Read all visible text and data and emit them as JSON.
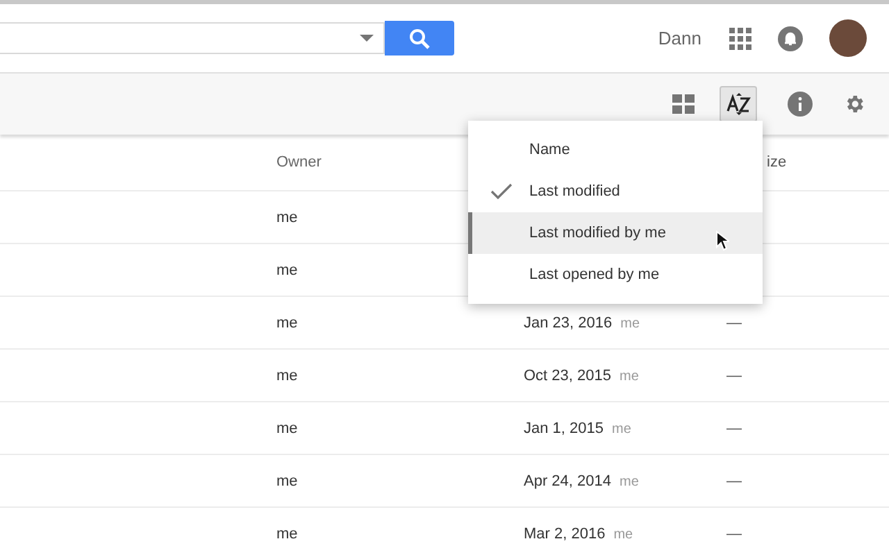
{
  "header": {
    "user_name": "Dann"
  },
  "table": {
    "columns": [
      "Owner",
      "ize"
    ],
    "rows": [
      {
        "owner": "me"
      },
      {
        "owner": "me"
      },
      {
        "owner": "me",
        "modified": "Jan 23, 2016",
        "modified_by": "me",
        "size": "—"
      },
      {
        "owner": "me",
        "modified": "Oct 23, 2015",
        "modified_by": "me",
        "size": "—"
      },
      {
        "owner": "me",
        "modified": "Jan 1, 2015",
        "modified_by": "me",
        "size": "—"
      },
      {
        "owner": "me",
        "modified": "Apr 24, 2014",
        "modified_by": "me",
        "size": "—"
      },
      {
        "owner": "me",
        "modified": "Mar 2, 2016",
        "modified_by": "me",
        "size": "—"
      }
    ]
  },
  "sort_menu": {
    "items": [
      {
        "label": "Name",
        "checked": false,
        "selected": false
      },
      {
        "label": "Last modified",
        "checked": true,
        "selected": false
      },
      {
        "label": "Last modified by me",
        "checked": false,
        "selected": true
      },
      {
        "label": "Last opened by me",
        "checked": false,
        "selected": false
      }
    ]
  }
}
